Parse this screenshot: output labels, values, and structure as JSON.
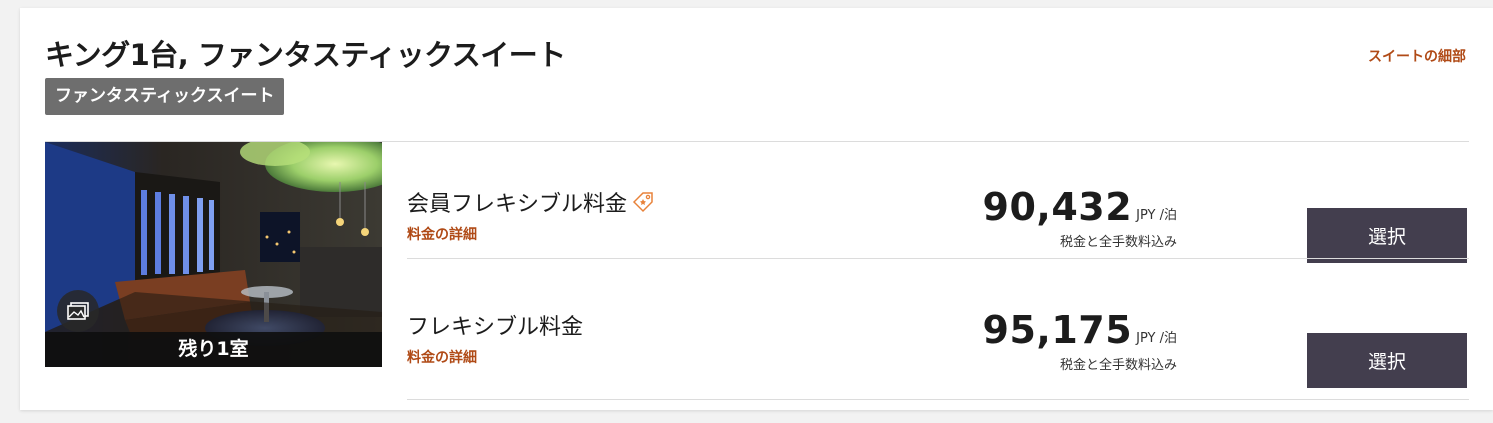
{
  "room": {
    "title": "キング1台, ファンタスティックスイート",
    "badge": "ファンタスティックスイート",
    "suite_details_link": "スイートの細部",
    "remaining": "残り1室",
    "gallery_icon": "photo-gallery-icon"
  },
  "rates": [
    {
      "name": "会員フレキシブル料金",
      "has_member_tag": true,
      "details_link": "料金の詳細",
      "price": "90,432",
      "unit": "JPY /泊",
      "note": "税金と全手数料込み",
      "button": "選択"
    },
    {
      "name": "フレキシブル料金",
      "has_member_tag": false,
      "details_link": "料金の詳細",
      "price": "95,175",
      "unit": "JPY /泊",
      "note": "税金と全手数料込み",
      "button": "選択"
    }
  ],
  "colors": {
    "accent_link": "#b04a16",
    "button_bg": "#433e4e",
    "badge_bg": "#6e6e6e",
    "tag_icon": "#e8823a"
  }
}
